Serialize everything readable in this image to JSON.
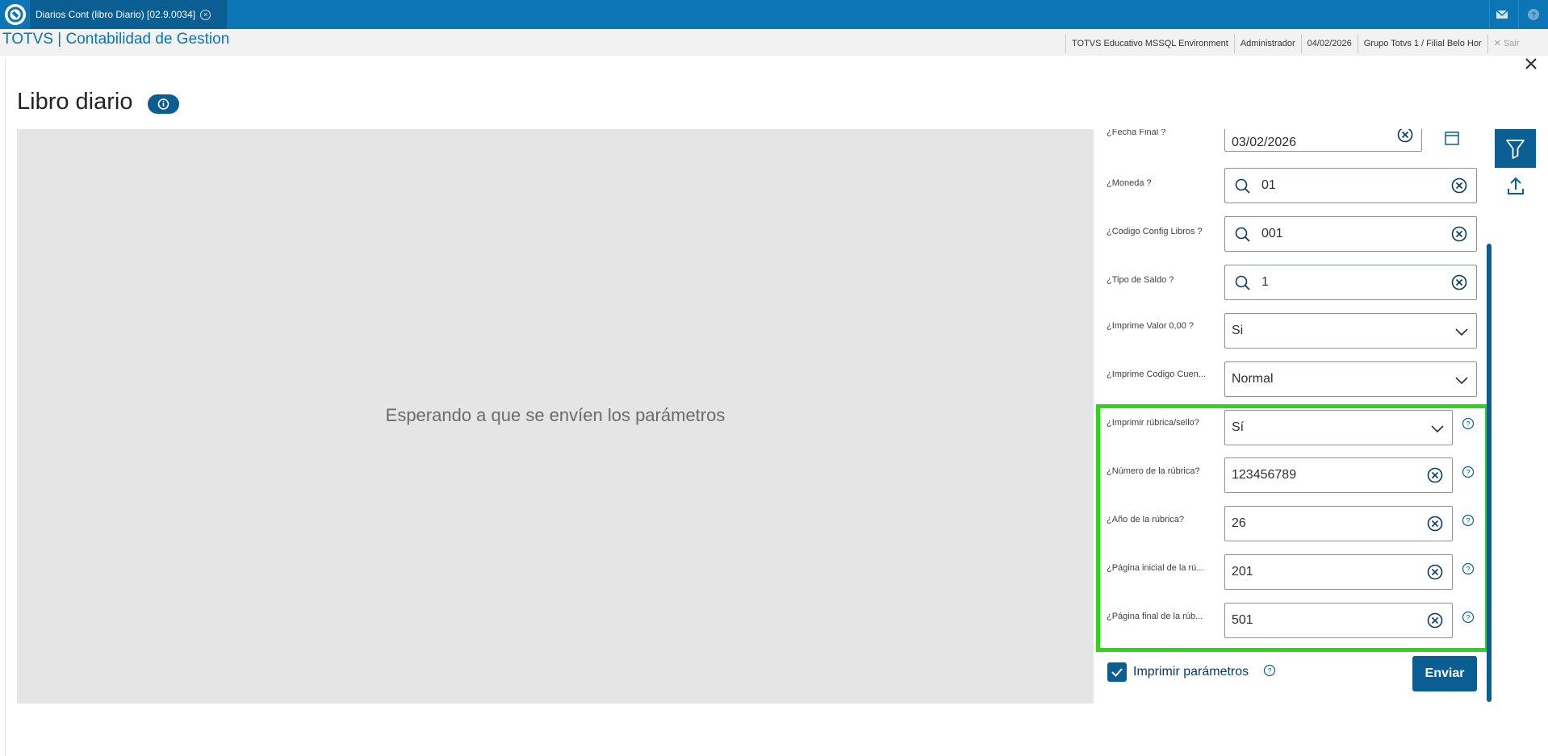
{
  "window": {
    "tab_title": "Diarios Cont (libro Diario) [02.9.0034]"
  },
  "header": {
    "app_title": "TOTVS | Contabilidad de Gestion",
    "context": {
      "environment": "TOTVS Educativo MSSQL Environment",
      "user": "Administrador",
      "date": "04/02/2026",
      "branch": "Grupo Totvs 1 / Filial Belo Hor",
      "logout": "Sair"
    }
  },
  "page": {
    "title": "Libro diario",
    "waiting_message": "Esperando a que se envíen los parámetros"
  },
  "params": [
    {
      "label": "¿Fecha Final ?",
      "value": "03/02/2026",
      "kind": "date"
    },
    {
      "label": "¿Moneda ?",
      "value": "01",
      "kind": "lookup"
    },
    {
      "label": "¿Codigo Config Libros ?",
      "value": "001",
      "kind": "lookup"
    },
    {
      "label": "¿Tipo de Saldo ?",
      "value": "1",
      "kind": "lookup"
    },
    {
      "label": "¿Imprime Valor 0,00 ?",
      "value": "Si",
      "kind": "select"
    },
    {
      "label": "¿Imprime Codigo Cuen...",
      "value": "Normal",
      "kind": "select"
    },
    {
      "label": "¿Imprimir rúbrica/sello?",
      "value": "Sí",
      "kind": "select"
    },
    {
      "label": "¿Número de la rúbrica?",
      "value": "123456789",
      "kind": "text"
    },
    {
      "label": "¿Año de la rúbrica?",
      "value": "26",
      "kind": "text"
    },
    {
      "label": "¿Página inicial de la rú...",
      "value": "201",
      "kind": "text"
    },
    {
      "label": "¿Página final de la rúb...",
      "value": "501",
      "kind": "text"
    }
  ],
  "print_params": {
    "label": "Imprimir parámetros",
    "checked": true
  },
  "actions": {
    "send_label": "Enviar"
  },
  "colors": {
    "brand_blue": "#0c75b5",
    "dark_blue": "#0a5e92",
    "highlight_green": "#2ed51b"
  }
}
